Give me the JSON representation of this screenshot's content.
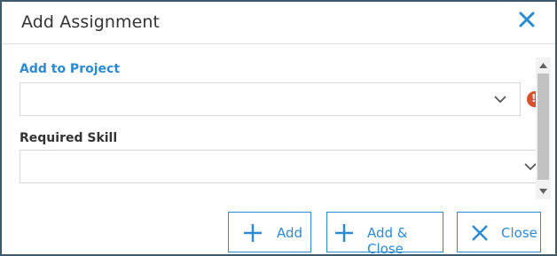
{
  "dialog": {
    "title": "Add Assignment",
    "close_icon": "close-icon"
  },
  "form": {
    "project": {
      "label": "Add to Project",
      "value": "",
      "status_icon": "error-icon"
    },
    "skill": {
      "label": "Required Skill",
      "value": ""
    }
  },
  "footer": {
    "add_label": "Add",
    "add_close_label": "Add & Close",
    "close_label": "Close"
  },
  "colors": {
    "accent": "#2a8ad4",
    "error": "#d94f2b",
    "frame": "#3d5a6c"
  }
}
